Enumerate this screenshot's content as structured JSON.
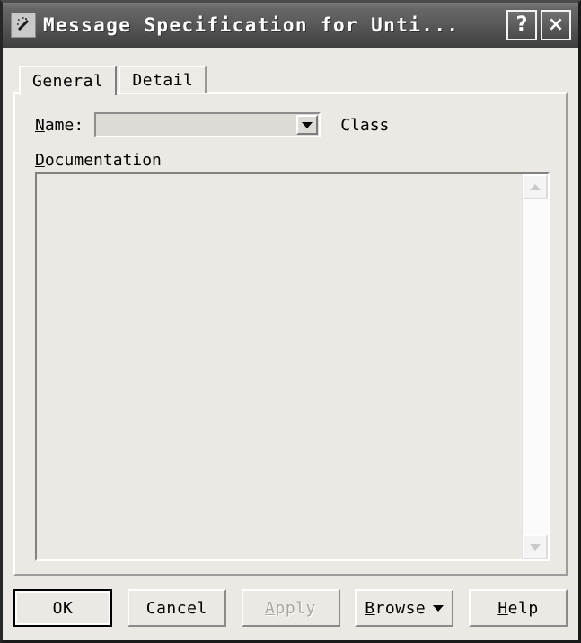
{
  "window": {
    "title": "Message Specification for Unti...",
    "icon": "magic-wand-icon",
    "help_button_label": "?",
    "close_button_label": "×",
    "background_color": "#ece9e4",
    "titlebar_color": "#5a5a5a"
  },
  "tabs": [
    {
      "label": "General",
      "selected": true
    },
    {
      "label": "Detail",
      "selected": false
    }
  ],
  "general": {
    "name_label_prefix": "N",
    "name_label_rest": "ame:",
    "name_value": "",
    "name_dropdown_icon": "chevron-down-icon",
    "class_label": "Class",
    "documentation_label_prefix": "D",
    "documentation_label_rest": "ocumentation",
    "documentation_value": "",
    "scrollbar_up_icon": "scroll-up-arrow-icon",
    "scrollbar_down_icon": "scroll-down-arrow-icon"
  },
  "footer": {
    "ok_label": "OK",
    "cancel_label": "Cancel",
    "apply_prefix": "A",
    "apply_rest": "pply",
    "apply_disabled": true,
    "browse_prefix": "B",
    "browse_rest": "rowse",
    "browse_dropdown_icon": "caret-down-icon",
    "help_prefix": "H",
    "help_rest": "elp"
  }
}
